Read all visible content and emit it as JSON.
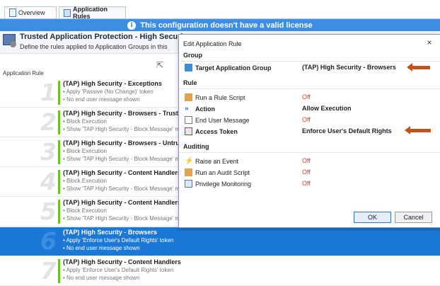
{
  "tabs": [
    {
      "label": "Overview"
    },
    {
      "label": "Application Rules"
    }
  ],
  "banner": {
    "text": "This configuration doesn't have a valid license"
  },
  "header": {
    "title": "Trusted Application Protection - High Securi",
    "subtitle": "Define the rules applied to Application Groups in this"
  },
  "column_label": "Application Rule",
  "rules": [
    {
      "num": "1",
      "title": "(TAP) High Security - Exceptions",
      "d1": "• Apply 'Passive (No Change)' token",
      "d2": "• No end user message shown",
      "selected": false
    },
    {
      "num": "2",
      "title": "(TAP) High Security - Browsers - Truste",
      "d1": "• Block Execution",
      "d2": "• Show 'TAP High Security - Block Message' m",
      "selected": false
    },
    {
      "num": "3",
      "title": "(TAP) High Security - Browsers - Untru",
      "d1": "• Block Execution",
      "d2": "• Show 'TAP High Security - Block Message' m",
      "selected": false
    },
    {
      "num": "4",
      "title": "(TAP) High Security - Content Handlers",
      "d1": "• Block Execution",
      "d2": "• Show 'TAP High Security - Block Message' m",
      "selected": false
    },
    {
      "num": "5",
      "title": "(TAP) High Security - Content Handlers",
      "d1": "• Block Execution",
      "d2": "• Show 'TAP High Security - Block Message' m",
      "selected": false
    },
    {
      "num": "6",
      "title": "(TAP) High Security - Browsers",
      "d1": "• Apply 'Enforce User's Default Rights' token",
      "d2": "• No end user message shown",
      "selected": true
    },
    {
      "num": "7",
      "title": "(TAP) High Security - Content Handlers",
      "d1": "• Apply 'Enforce User's Default Rights' token",
      "d2": "• No end user message shown",
      "selected": false
    }
  ],
  "dialog": {
    "title": "Edit Application Rule",
    "close": "×",
    "sections": {
      "group": "Group",
      "rule": "Rule",
      "auditing": "Auditing"
    },
    "group": {
      "label": "Target Application Group",
      "value": "(TAP) High Security - Browsers"
    },
    "rule": {
      "script": {
        "label": "Run a Rule Script",
        "value": "Off"
      },
      "action": {
        "label": "Action",
        "value": "Allow Execution"
      },
      "message": {
        "label": "End User Message",
        "value": "Off"
      },
      "token": {
        "label": "Access Token",
        "value": "Enforce User's Default Rights"
      }
    },
    "auditing": {
      "event": {
        "label": "Raise an Event",
        "value": "Off"
      },
      "audit": {
        "label": "Run an Audit Script",
        "value": "Off"
      },
      "priv": {
        "label": "Privilege Monitoring",
        "value": "Off"
      }
    },
    "buttons": {
      "ok": "OK",
      "cancel": "Cancel"
    }
  },
  "colors": {
    "banner": "#3c8ee3",
    "selected_row": "#1b78d7",
    "arrow": "#c4531b",
    "off_value": "#d83c2b",
    "rule_bar": "#6cc61e"
  }
}
